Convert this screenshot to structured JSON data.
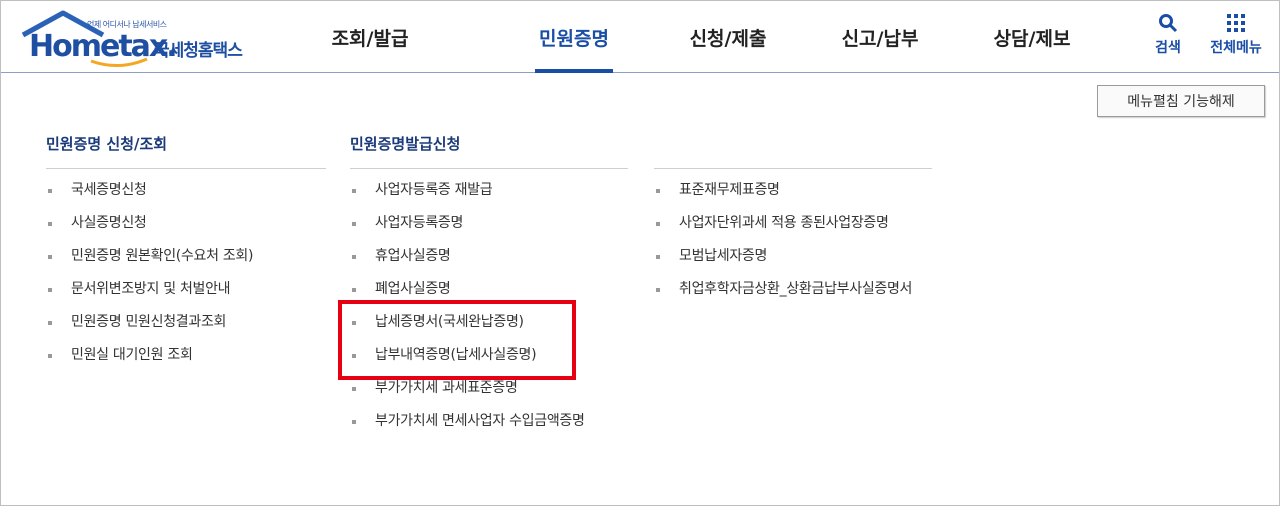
{
  "logo": {
    "sub": "언제 어디서나 납세서비스",
    "main": "Hometax.",
    "kr": "국세청홈택스"
  },
  "nav": [
    "조회/발급",
    "민원증명",
    "신청/제출",
    "신고/납부",
    "상담/제보"
  ],
  "util": {
    "search": "검색",
    "menu": "전체메뉴"
  },
  "fold_button": "메뉴펼침 기능해제",
  "columns": [
    {
      "title": "민원증명 신청/조회",
      "items": [
        "국세증명신청",
        "사실증명신청",
        "민원증명 원본확인(수요처 조회)",
        "문서위변조방지 및 처벌안내",
        "민원증명 민원신청결과조회",
        "민원실 대기인원 조회"
      ]
    },
    {
      "title": "민원증명발급신청",
      "items": [
        "사업자등록증 재발급",
        "사업자등록증명",
        "휴업사실증명",
        "폐업사실증명",
        "납세증명서(국세완납증명)",
        "납부내역증명(납세사실증명)",
        "부가가치세 과세표준증명",
        "부가가치세 면세사업자 수입금액증명"
      ]
    },
    {
      "title": "",
      "items": [
        "표준재무제표증명",
        "사업자단위과세 적용 종된사업장증명",
        "모범납세자증명",
        "취업후학자금상환_상환금납부사실증명서"
      ]
    }
  ],
  "colors": {
    "brand": "#1a4ea6",
    "highlight": "#e60012"
  }
}
